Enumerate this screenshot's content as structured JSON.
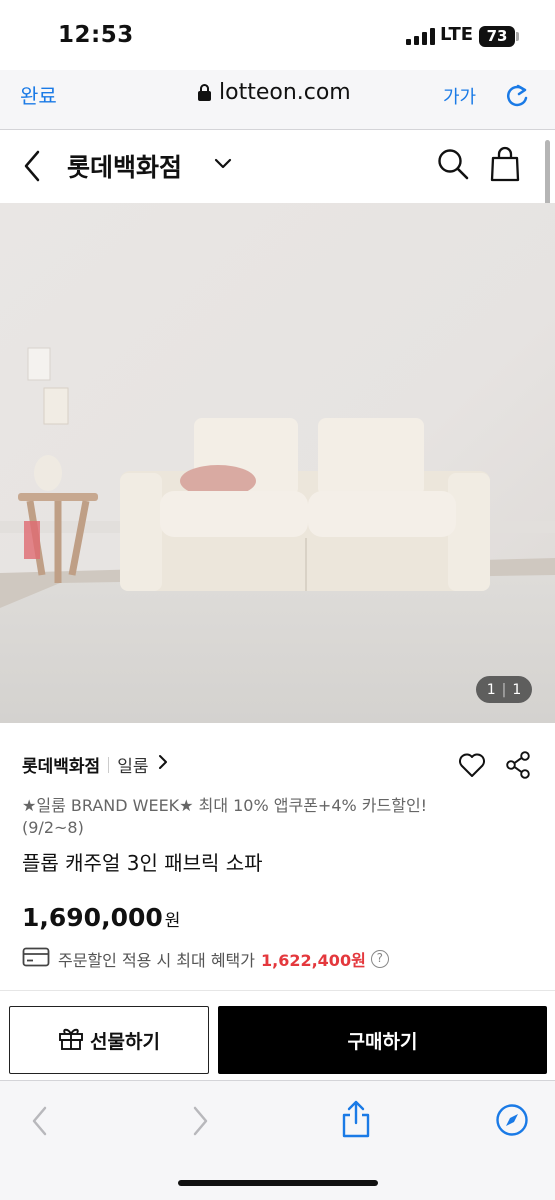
{
  "status_bar": {
    "time": "12:53",
    "network": "LTE",
    "battery": "73"
  },
  "browser": {
    "done_label": "완료",
    "url": "lotteon.com",
    "text_size_label": "가가"
  },
  "header": {
    "store_name": "롯데백화점"
  },
  "gallery": {
    "current": "1",
    "total": "1"
  },
  "product": {
    "store": "롯데백화점",
    "brand": "일룸",
    "promo": "★일룸 BRAND WEEK★ 최대 10% 앱쿠폰+4% 카드할인! (9/2~8)",
    "name": "플롭 캐주얼 3인 패브릭 소파",
    "price": "1,690,000",
    "price_unit": "원",
    "benefit_label": "주문할인 적용 시 최대 혜택가",
    "benefit_price": "1,622,400원",
    "help_glyph": "?"
  },
  "actions": {
    "gift_label": "선물하기",
    "buy_label": "구매하기"
  },
  "colors": {
    "ios_blue": "#1a7ae6",
    "benefit_red": "#e4383d",
    "buy_button": "#000000"
  }
}
